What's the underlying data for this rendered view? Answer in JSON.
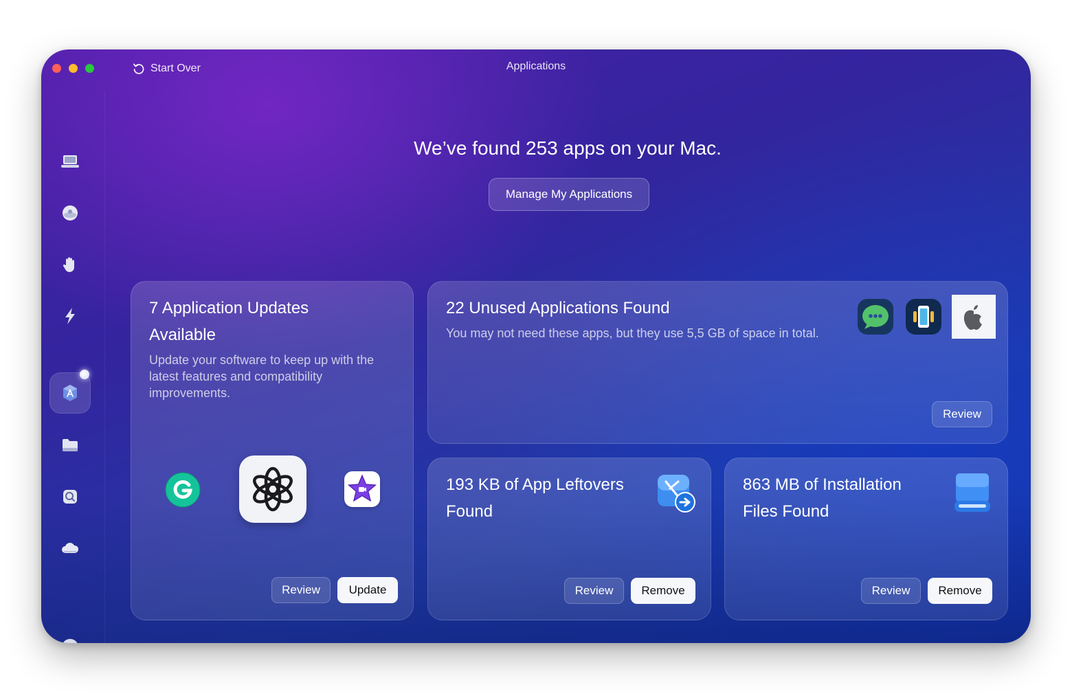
{
  "window": {
    "title": "Applications",
    "start_over_label": "Start Over"
  },
  "sidebar": {
    "items": [
      {
        "name": "smart-scan",
        "icon": "laptop-icon"
      },
      {
        "name": "cleanup",
        "icon": "disk-icon"
      },
      {
        "name": "protection",
        "icon": "hand-icon"
      },
      {
        "name": "performance",
        "icon": "lightning-icon"
      },
      {
        "name": "applications",
        "icon": "app-store-icon",
        "active": true
      },
      {
        "name": "my-clutter",
        "icon": "folder-icon"
      },
      {
        "name": "space-lens",
        "icon": "lens-icon"
      },
      {
        "name": "cloud-cleanup",
        "icon": "cloud-icon"
      },
      {
        "name": "assistant",
        "icon": "assistant-icon"
      }
    ]
  },
  "main": {
    "headline": "We’ve found 253 apps on your Mac.",
    "manage_button": "Manage My Applications"
  },
  "cards": {
    "updates": {
      "title_line1": "7 Application Updates",
      "title_line2": "Available",
      "description": "Update your software to keep up with the latest features and compatibility improvements.",
      "apps": [
        "Grammarly",
        "ChatGPT",
        "iMovie"
      ],
      "review_label": "Review",
      "update_label": "Update"
    },
    "unused": {
      "title": "22 Unused Applications Found",
      "description": "You may not need these apps, but they use 5,5 GB of space in total.",
      "apps": [
        "Messages",
        "Device app",
        "Apple"
      ],
      "review_label": "Review"
    },
    "leftovers": {
      "title_line1": "193 KB of App Leftovers",
      "title_line2": "Found",
      "review_label": "Review",
      "remove_label": "Remove"
    },
    "installation": {
      "title_line1": "863 MB of Installation",
      "title_line2": "Files Found",
      "review_label": "Review",
      "remove_label": "Remove"
    }
  },
  "colors": {
    "close": "#fe5f57",
    "minimize": "#febc2e",
    "zoom": "#28c840",
    "grammarly": "#15c39a",
    "imovie": "#7b3fe4"
  }
}
